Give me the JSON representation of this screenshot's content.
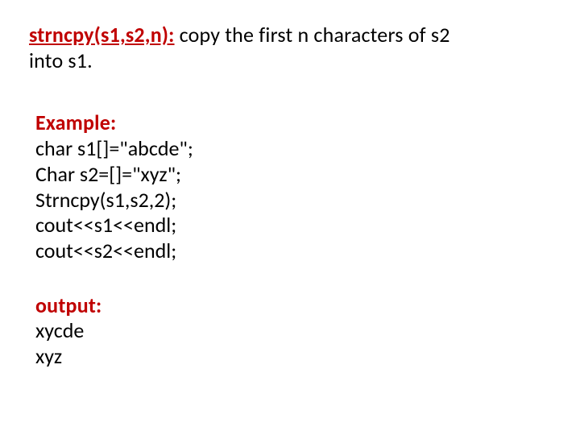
{
  "header": {
    "signature": "strncpy(s1,s2,n):",
    "desc_part1": " copy the first n characters of s2",
    "desc_part2": "into s1."
  },
  "example": {
    "label": "Example:",
    "lines": [
      " char s1[]=\"abcde\";",
      "Char s2=[]=\"xyz\";",
      "Strncpy(s1,s2,2);",
      "cout<<s1<<endl;",
      "cout<<s2<<endl;"
    ]
  },
  "output": {
    "label": "output:",
    "lines": [
      "xycde",
      "xyz"
    ]
  }
}
